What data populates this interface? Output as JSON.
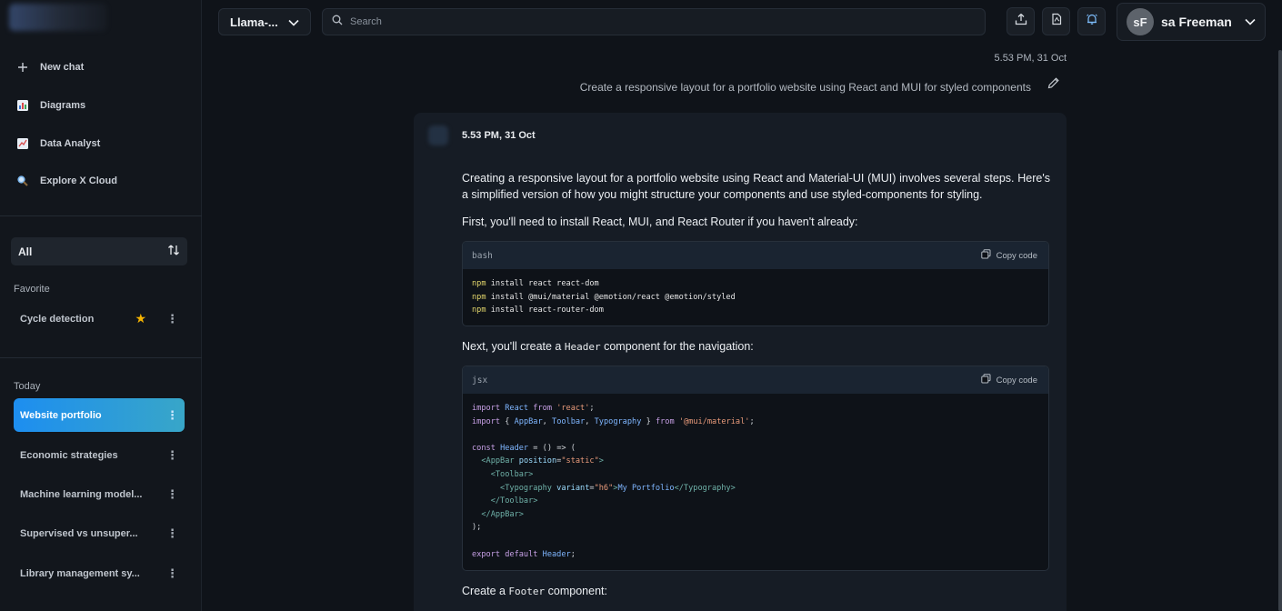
{
  "sidebar": {
    "nav": [
      {
        "label": "New chat",
        "icon": "plus-icon"
      },
      {
        "label": "Diagrams",
        "icon": "bar-chart-icon"
      },
      {
        "label": "Data Analyst",
        "icon": "line-chart-icon"
      },
      {
        "label": "Explore X Cloud",
        "icon": "magnifier-icon"
      }
    ],
    "filter_label": "All",
    "favorite_label": "Favorite",
    "favorites": [
      {
        "label": "Cycle detection"
      }
    ],
    "today_label": "Today",
    "chats": [
      {
        "label": "Website portfolio"
      },
      {
        "label": "Economic strategies"
      },
      {
        "label": "Machine learning model..."
      },
      {
        "label": "Supervised vs unsuper..."
      },
      {
        "label": "Library management sy..."
      }
    ]
  },
  "topbar": {
    "model": "Llama-...",
    "search_placeholder": "Search",
    "user_initials": "sF",
    "user_name": "sa Freeman"
  },
  "conversation": {
    "user_timestamp": "5.53 PM, 31 Oct",
    "user_message": "Create a responsive layout for a portfolio website using React and MUI for styled components",
    "bot_timestamp": "5.53 PM, 31 Oct",
    "intro": "Creating a responsive layout for a portfolio website using React and Material-UI (MUI) involves several steps. Here's a simplified version of how you might structure your components and use styled-components for styling.",
    "step1": "First, you'll need to install React, MUI, and React Router if you haven't already:",
    "step2_pre": "Next, you'll create a ",
    "step2_code": "Header",
    "step2_post": " component for the navigation:",
    "step3_pre": "Create a ",
    "step3_code": "Footer",
    "step3_post": " component:",
    "copy_label": "Copy code",
    "code_blocks": [
      {
        "lang": "bash",
        "lines": [
          "npm install react react-dom",
          "npm install @mui/material @emotion/react @emotion/styled",
          "npm install react-router-dom"
        ]
      },
      {
        "lang": "jsx",
        "lines": [
          "import React from 'react';",
          "import { AppBar, Toolbar, Typography } from '@mui/material';",
          "",
          "const Header = () => (",
          "  <AppBar position=\"static\">",
          "    <Toolbar>",
          "      <Typography variant=\"h6\">My Portfolio</Typography>",
          "    </Toolbar>",
          "  </AppBar>",
          ");",
          "",
          "export default Header;"
        ]
      }
    ]
  },
  "colors": {
    "accent": "#1d8ef0",
    "background": "#0f1319",
    "card": "#161c25",
    "star": "#f5b301"
  }
}
